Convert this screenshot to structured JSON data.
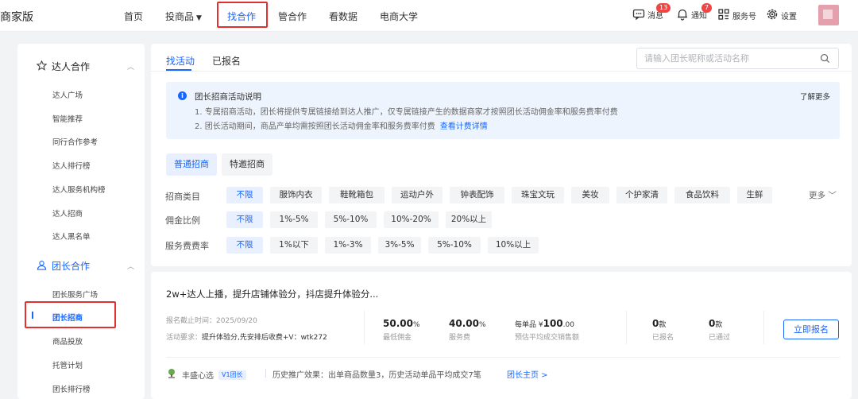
{
  "brand": "商家版",
  "nav": [
    {
      "label": "首页"
    },
    {
      "label": "投商品"
    },
    {
      "label": "找合作"
    },
    {
      "label": "管合作"
    },
    {
      "label": "看数据"
    },
    {
      "label": "电商大学"
    }
  ],
  "tools": {
    "messages": {
      "label": "消息",
      "badge": "13",
      "icon": "message-icon"
    },
    "notify": {
      "label": "通知",
      "badge": "7",
      "icon": "bell-icon"
    },
    "service": {
      "label": "服务号",
      "icon": "grid-icon"
    },
    "settings": {
      "label": "设置",
      "icon": "gear-icon"
    }
  },
  "sidebar": {
    "group1": {
      "label": "达人合作",
      "icon": "star-icon"
    },
    "group1_items": [
      "达人广场",
      "智能推荐",
      "同行合作参考",
      "达人排行榜",
      "达人服务机构榜",
      "达人招商",
      "达人黑名单"
    ],
    "group2": {
      "label": "团长合作",
      "icon": "team-icon"
    },
    "group2_items": [
      "团长服务广场",
      "团长招商",
      "商品投放",
      "托管计划",
      "团长排行榜"
    ]
  },
  "tabs": [
    "找活动",
    "已报名"
  ],
  "search": {
    "placeholder": "请输入团长昵称或活动名称"
  },
  "notice": {
    "title": "团长招商活动说明",
    "more": "了解更多",
    "line1": "1. 专属招商活动，团长将提供专属链接给到达人推广，仅专属链接产生的数据商家才按照团长活动佣金率和服务费率付费",
    "line2": "2. 团长活动期间，商品产单均需按照团长活动佣金率和服务费率付费",
    "link": "查看计费详情"
  },
  "segments": [
    "普通招商",
    "特邀招商"
  ],
  "filters": {
    "category": {
      "label": "招商类目",
      "options": [
        "不限",
        "服饰内衣",
        "鞋靴箱包",
        "运动户外",
        "钟表配饰",
        "珠宝文玩",
        "美妆",
        "个护家清",
        "食品饮料",
        "生鲜"
      ],
      "more": "更多"
    },
    "commission": {
      "label": "佣金比例",
      "options": [
        "不限",
        "1%-5%",
        "5%-10%",
        "10%-20%",
        "20%以上"
      ]
    },
    "service": {
      "label": "服务费费率",
      "options": [
        "不限",
        "1%以下",
        "1%-3%",
        "3%-5%",
        "5%-10%",
        "10%以上"
      ]
    }
  },
  "activity": {
    "title": "2w+达人上播，提升店铺体验分，抖店提升体验分...",
    "deadline_label": "报名截止时间：",
    "deadline": "2025/09/20",
    "req_label": "活动要求：",
    "requirement": "提升体验分,先安排后收费+V：wtk272",
    "commission": {
      "value": "50.00",
      "unit": "%",
      "label": "最低佣金"
    },
    "service_fee": {
      "value": "40.00",
      "unit": "%",
      "label": "服务费"
    },
    "sales": {
      "prefix": "每单品 ¥",
      "value": "100",
      "suffix": ".00",
      "label": "预估平均成交销售额"
    },
    "signed": {
      "value": "0",
      "unit": "款",
      "label": "已报名"
    },
    "passed": {
      "value": "0",
      "unit": "款",
      "label": "已通过"
    },
    "apply_label": "立即报名",
    "leader_name": "丰盛心选",
    "leader_level": "V1团长",
    "history": "历史推广效果：出单商品数量3，历史活动单品平均成交7笔",
    "home_link": "团长主页 >"
  }
}
